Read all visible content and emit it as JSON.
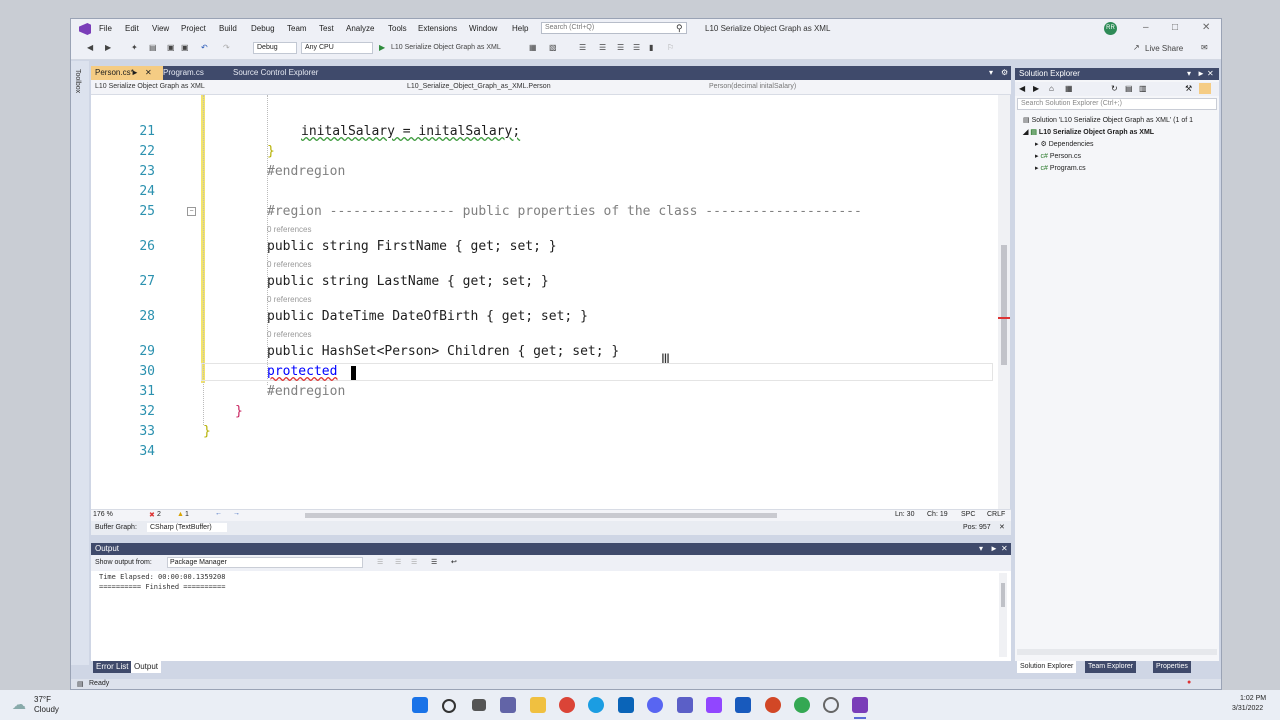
{
  "menu": [
    "File",
    "Edit",
    "View",
    "Project",
    "Build",
    "Debug",
    "Team",
    "Test",
    "Analyze",
    "Tools",
    "Extensions",
    "Window",
    "Help"
  ],
  "search_placeholder": "Search (Ctrl+Q)",
  "window_title": "L10 Serialize Object Graph as XML",
  "user_initials": "RR",
  "live_share": "Live Share",
  "toolbar": {
    "config": "Debug",
    "platform": "Any CPU",
    "run": "L10 Serialize Object Graph as XML"
  },
  "toolbox_label": "Toolbox",
  "doc_tabs": [
    "Person.cs*",
    "Program.cs",
    "Source Control Explorer"
  ],
  "nav": {
    "project": "L10 Serialize Object Graph as XML",
    "type": "L10_Serialize_Object_Graph_as_XML.Person",
    "member": "Person(decimal initalSalary)"
  },
  "editor": {
    "ref_text": "0 references",
    "lines": [
      {
        "n": "21",
        "code": "initalSalary = initalSalary;"
      },
      {
        "n": "22",
        "code": "}"
      },
      {
        "n": "23",
        "code": "#endregion"
      },
      {
        "n": "24",
        "code": ""
      },
      {
        "n": "25",
        "code": "#region ---------------- public properties of the class --------------------"
      },
      {
        "n": "26",
        "code": "public string FirstName { get; set; }"
      },
      {
        "n": "27",
        "code": "public string LastName { get; set; }"
      },
      {
        "n": "28",
        "code": "public DateTime DateOfBirth { get; set; }"
      },
      {
        "n": "29",
        "code": "public HashSet<Person> Children { get; set; }"
      },
      {
        "n": "30",
        "code": "protected"
      },
      {
        "n": "31",
        "code": "#endregion"
      },
      {
        "n": "32",
        "code": "}"
      },
      {
        "n": "33",
        "code": "}"
      },
      {
        "n": "34",
        "code": ""
      }
    ]
  },
  "editor_status": {
    "zoom": "176 %",
    "errors": "2",
    "warnings": "1",
    "ln": "Ln: 30",
    "ch": "Ch: 19",
    "spc": "SPC",
    "crlf": "CRLF"
  },
  "buffer": {
    "label": "Buffer Graph:",
    "value": "CSharp (TextBuffer)",
    "pos": "Pos: 957"
  },
  "output": {
    "title": "Output",
    "show_from_label": "Show output from:",
    "source": "Package Manager",
    "lines": [
      "Time Elapsed: 00:00:00.1359208",
      "========== Finished =========="
    ]
  },
  "bottom_tabs": [
    "Error List",
    "Output"
  ],
  "solution_explorer": {
    "title": "Solution Explorer",
    "search": "Search Solution Explorer (Ctrl+;)",
    "solution": "Solution 'L10 Serialize Object Graph as XML' (1 of 1",
    "project": "L10 Serialize Object Graph as XML",
    "items": [
      "Dependencies",
      "Person.cs",
      "Program.cs"
    ]
  },
  "se_tabs": [
    "Solution Explorer",
    "Team Explorer",
    "Properties"
  ],
  "status": "Ready",
  "weather": {
    "temp": "37°F",
    "cond": "Cloudy"
  },
  "clock": {
    "time": "1:02 PM",
    "date": "3/31/2022"
  }
}
